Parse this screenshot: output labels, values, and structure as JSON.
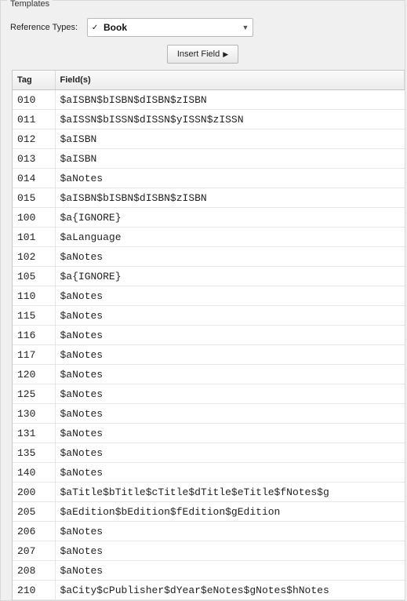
{
  "panel": {
    "title": "Templates"
  },
  "ref": {
    "label": "Reference Types:",
    "checkmark": "✓",
    "selected": "Book"
  },
  "buttons": {
    "insert_field": "Insert Field"
  },
  "table": {
    "headers": {
      "tag": "Tag",
      "fields": "Field(s)"
    },
    "rows": [
      {
        "tag": "010",
        "fields": "$aISBN$bISBN$dISBN$zISBN"
      },
      {
        "tag": "011",
        "fields": "$aISSN$bISSN$dISSN$yISSN$zISSN"
      },
      {
        "tag": "012",
        "fields": "$aISBN"
      },
      {
        "tag": "013",
        "fields": "$aISBN"
      },
      {
        "tag": "014",
        "fields": "$aNotes"
      },
      {
        "tag": "015",
        "fields": "$aISBN$bISBN$dISBN$zISBN"
      },
      {
        "tag": "100",
        "fields": "$a{IGNORE}"
      },
      {
        "tag": "101",
        "fields": "$aLanguage"
      },
      {
        "tag": "102",
        "fields": "$aNotes"
      },
      {
        "tag": "105",
        "fields": "$a{IGNORE}"
      },
      {
        "tag": "110",
        "fields": "$aNotes"
      },
      {
        "tag": "115",
        "fields": "$aNotes"
      },
      {
        "tag": "116",
        "fields": "$aNotes"
      },
      {
        "tag": "117",
        "fields": "$aNotes"
      },
      {
        "tag": "120",
        "fields": "$aNotes"
      },
      {
        "tag": "125",
        "fields": "$aNotes"
      },
      {
        "tag": "130",
        "fields": "$aNotes"
      },
      {
        "tag": "131",
        "fields": "$aNotes"
      },
      {
        "tag": "135",
        "fields": "$aNotes"
      },
      {
        "tag": "140",
        "fields": "$aNotes"
      },
      {
        "tag": "200",
        "fields": "$aTitle$bTitle$cTitle$dTitle$eTitle$fNotes$g"
      },
      {
        "tag": "205",
        "fields": "$aEdition$bEdition$fEdition$gEdition"
      },
      {
        "tag": "206",
        "fields": "$aNotes"
      },
      {
        "tag": "207",
        "fields": "$aNotes"
      },
      {
        "tag": "208",
        "fields": "$aNotes"
      },
      {
        "tag": "210",
        "fields": "$aCity$cPublisher$dYear$eNotes$gNotes$hNotes"
      }
    ]
  }
}
